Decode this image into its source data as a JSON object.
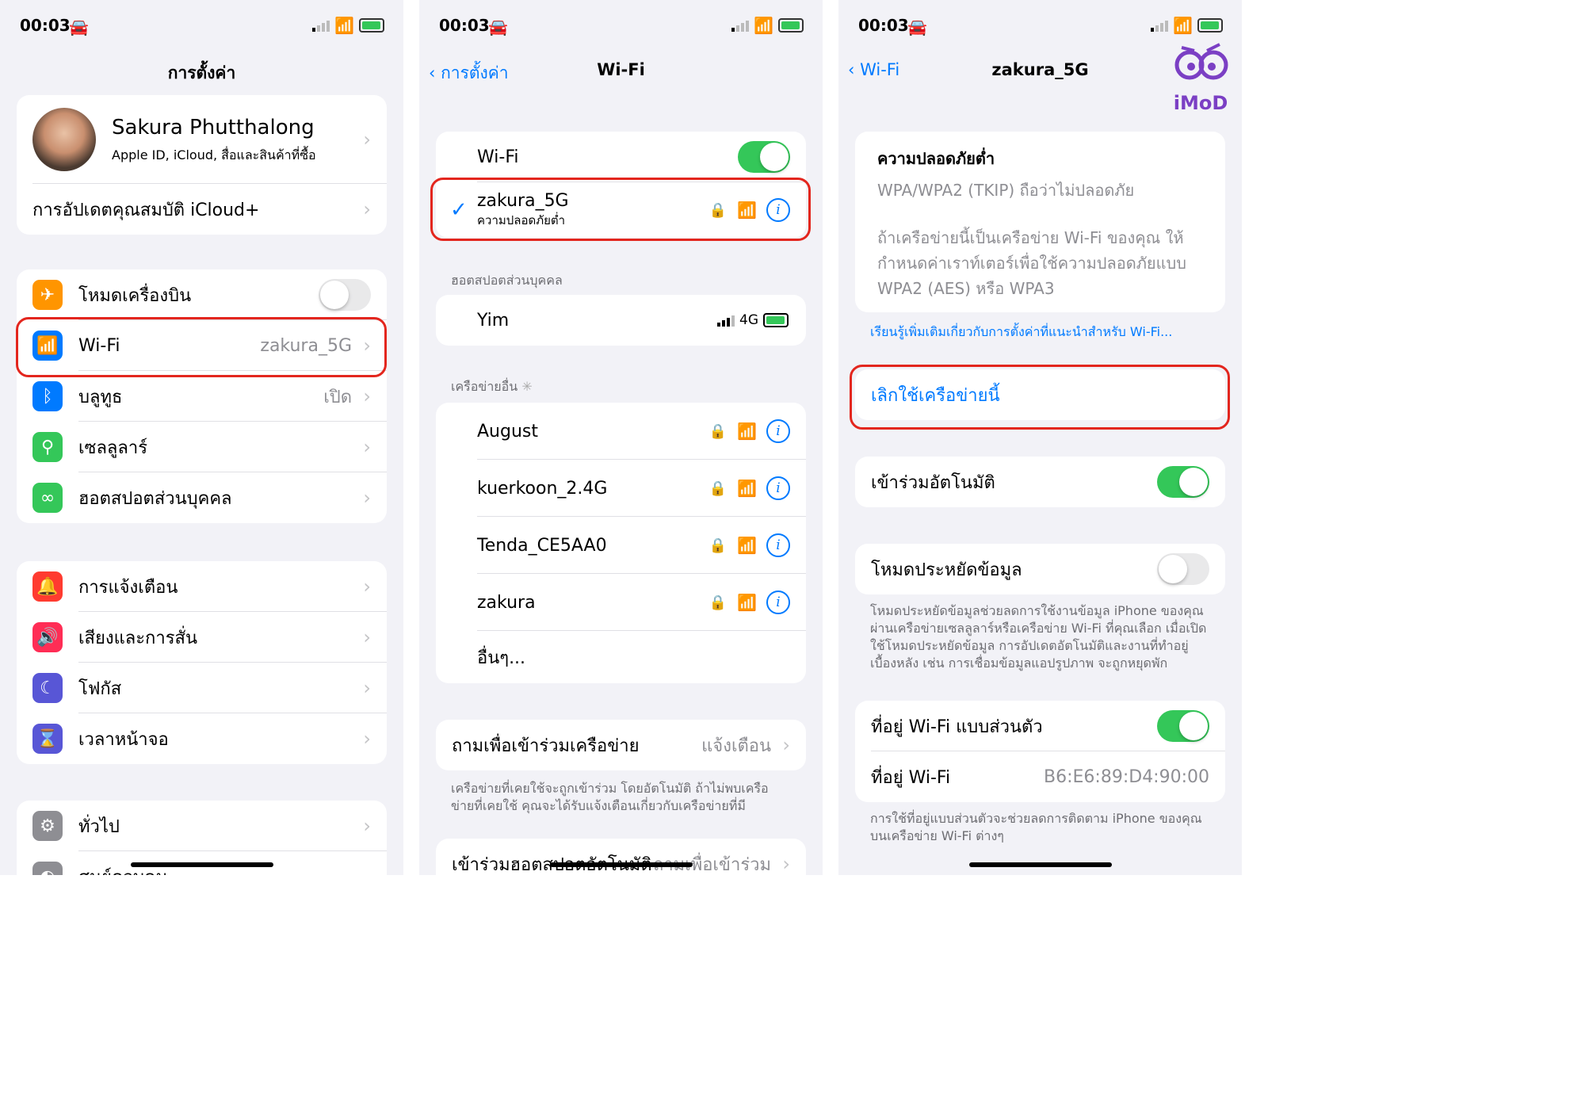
{
  "status": {
    "time": "00:03",
    "time2": "00:03",
    "time3": "00:03"
  },
  "s1": {
    "title": "การตั้งค่า",
    "profile": {
      "name": "Sakura Phutthalong",
      "sub": "Apple ID, iCloud, สื่อและสินค้าที่ซื้อ"
    },
    "icloud_row": "การอัปเดตคุณสมบัติ iCloud+",
    "rows": {
      "airplane": "โหมดเครื่องบิน",
      "wifi": "Wi-Fi",
      "wifi_value": "zakura_5G",
      "bluetooth": "บลูทูธ",
      "bluetooth_value": "เปิด",
      "cellular": "เซลลูลาร์",
      "hotspot": "ฮอตสปอตส่วนบุคคล",
      "notifications": "การแจ้งเตือน",
      "sounds": "เสียงและการสั่น",
      "focus": "โฟกัส",
      "screentime": "เวลาหน้าจอ",
      "general": "ทั่วไป",
      "control": "ศูนย์ควบคุม"
    }
  },
  "s2": {
    "back": "การตั้งค่า",
    "title": "Wi-Fi",
    "wifi_label": "Wi-Fi",
    "current": {
      "name": "zakura_5G",
      "sub": "ความปลอดภัยต่ำ"
    },
    "hotspot_header": "ฮอตสปอตส่วนบุคคล",
    "hotspot": {
      "name": "Yim",
      "network": "4G"
    },
    "other_header": "เครือข่ายอื่น",
    "networks": [
      "August",
      "kuerkoon_2.4G",
      "Tenda_CE5AA0",
      "zakura"
    ],
    "other": "อื่นๆ...",
    "ask_label": "ถามเพื่อเข้าร่วมเครือข่าย",
    "ask_value": "แจ้งเตือน",
    "ask_caption": "เครือข่ายที่เคยใช้จะถูกเข้าร่วม โดยอัตโนมัติ ถ้าไม่พบเครือข่ายที่เคยใช้ คุณจะได้รับแจ้งเตือนเกี่ยวกับเครือข่ายที่มี",
    "auto_hotspot_label": "เข้าร่วมฮอตสปอตอัตโนมัติ",
    "auto_hotspot_value": "ถามเพื่อเข้าร่วม"
  },
  "s3": {
    "back": "Wi-Fi",
    "title": "zakura_5G",
    "logo": "iMoD",
    "security_title": "ความปลอดภัยต่ำ",
    "security_type": "WPA/WPA2 (TKIP) ถือว่าไม่ปลอดภัย",
    "security_desc": "ถ้าเครือข่ายนี้เป็นเครือข่าย Wi-Fi ของคุณ ให้กำหนดค่าเราท์เตอร์เพื่อใช้ความปลอดภัยแบบ WPA2 (AES) หรือ WPA3",
    "learn_more": "เรียนรู้เพิ่มเติมเกี่ยวกับการตั้งค่าที่แนะนำสำหรับ Wi-Fi...",
    "forget": "เลิกใช้เครือข่ายนี้",
    "auto_join": "เข้าร่วมอัตโนมัติ",
    "low_data": "โหมดประหยัดข้อมูล",
    "low_data_caption": "โหมดประหยัดข้อมูลช่วยลดการใช้งานข้อมูล iPhone ของคุณผ่านเครือข่ายเซลลูลาร์หรือเครือข่าย Wi-Fi ที่คุณเลือก เมื่อเปิดใช้โหมดประหยัดข้อมูล การอัปเดตอัตโนมัติและงานที่ทำอยู่เบื้องหลัง เช่น การเชื่อมข้อมูลแอปรูปภาพ จะถูกหยุดพัก",
    "private_addr": "ที่อยู่ Wi-Fi แบบส่วนตัว",
    "addr_label": "ที่อยู่ Wi-Fi",
    "addr_value": "B6:E6:89:D4:90:00",
    "addr_caption": "การใช้ที่อยู่แบบส่วนตัวจะช่วยลดการติดตาม iPhone ของคุณบนเครือข่าย Wi-Fi ต่างๆ"
  },
  "colors": {
    "accent": "#007aff",
    "highlight": "#e3261e",
    "toggle_on": "#34c759"
  }
}
